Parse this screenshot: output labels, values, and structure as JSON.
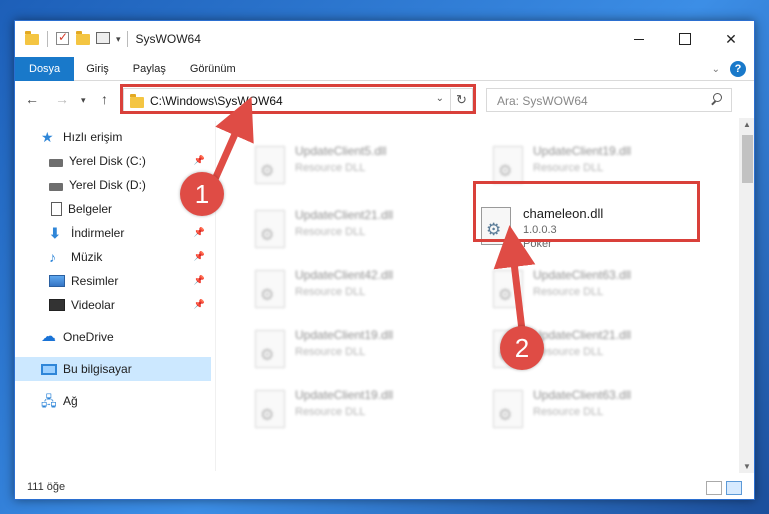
{
  "window": {
    "title": "SysWOW64"
  },
  "ribbon": {
    "tabs": [
      "Dosya",
      "Giriş",
      "Paylaş",
      "Görünüm"
    ],
    "help": "?"
  },
  "address": {
    "path": "C:\\Windows\\SysWOW64",
    "search_placeholder": "Ara: SysWOW64"
  },
  "nav": {
    "items": [
      {
        "label": "Hızlı erişim",
        "icon": "star-icon",
        "pinned": false
      },
      {
        "label": "Yerel Disk (C:)",
        "icon": "disk-icon",
        "pinned": true
      },
      {
        "label": "Yerel Disk (D:)",
        "icon": "disk-icon",
        "pinned": false
      },
      {
        "label": "Belgeler",
        "icon": "document-icon",
        "pinned": true
      },
      {
        "label": "İndirmeler",
        "icon": "download-icon",
        "pinned": true
      },
      {
        "label": "Müzik",
        "icon": "music-icon",
        "pinned": true
      },
      {
        "label": "Resimler",
        "icon": "pictures-icon",
        "pinned": true
      },
      {
        "label": "Videolar",
        "icon": "video-icon",
        "pinned": true
      },
      {
        "label": "OneDrive",
        "icon": "cloud-icon",
        "pinned": false
      },
      {
        "label": "Bu bilgisayar",
        "icon": "computer-icon",
        "pinned": false
      },
      {
        "label": "Ağ",
        "icon": "network-icon",
        "pinned": false
      }
    ]
  },
  "files": {
    "left_column": [
      {
        "name": "UpdateClient5.dll",
        "type": "Resource DLL"
      },
      {
        "name": "UpdateClient21.dll",
        "type": "Resource DLL"
      },
      {
        "name": "UpdateClient42.dll",
        "type": "Resource DLL"
      },
      {
        "name": "UpdateClient19.dll",
        "type": "Resource DLL"
      },
      {
        "name": "UpdateClient19.dll",
        "type": "Resource DLL"
      }
    ],
    "right_column": [
      {
        "name": "UpdateClient19.dll",
        "type": "Resource DLL"
      },
      {
        "name": "UpdateClient63.dll",
        "type": "Resource DLL"
      },
      {
        "name": "UpdateClient21.dll",
        "type": "Resource DLL"
      },
      {
        "name": "UpdateClient63.dll",
        "type": "Resource DLL"
      }
    ],
    "highlighted": {
      "name": "chameleon.dll",
      "version": "1.0.0.3",
      "company": "Poker"
    }
  },
  "status": {
    "count": "111 öğe"
  },
  "annotations": {
    "step1": "1",
    "step2": "2",
    "color": "#df4c45"
  }
}
